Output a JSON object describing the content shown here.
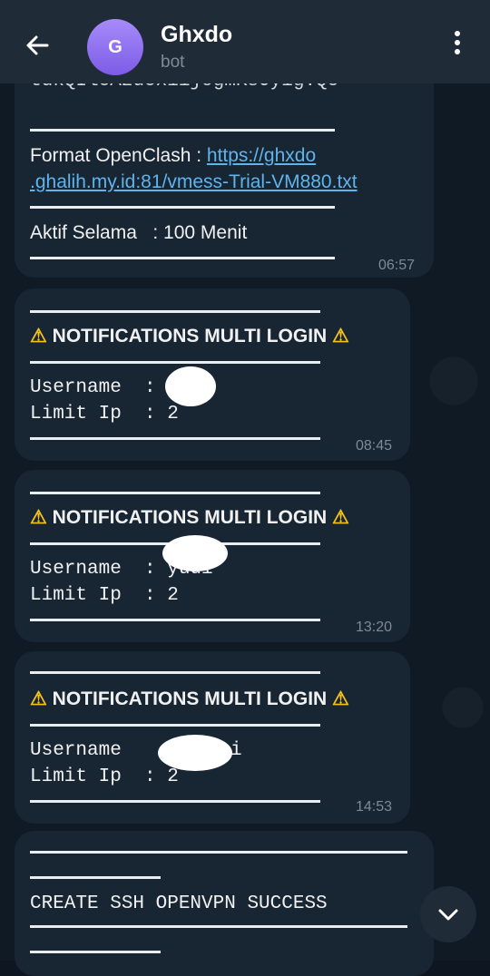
{
  "header": {
    "avatar_letter": "G",
    "title": "Ghxdo",
    "subtitle": "bot"
  },
  "messages": [
    {
      "partial_top_text": "tdkQIlcAzucxiijogmKsOyig:Qc",
      "format_label": "Format OpenClash : ",
      "format_link_line1": "https://ghxdo",
      "format_link_line2": ".ghalih.my.id:81/vmess-Trial-VM880.txt",
      "active_text": "Aktif Selama   : 100 Menit",
      "time": "06:57"
    },
    {
      "heading": "NOTIFICATIONS MULTI LOGIN",
      "username_label": "Username  :",
      "limit_label": "Limit Ip  : 2",
      "time": "08:45"
    },
    {
      "heading": "NOTIFICATIONS MULTI LOGIN",
      "username_label": "Username  : yudi",
      "limit_label": "Limit Ip  : 2",
      "time": "13:20"
    },
    {
      "heading": "NOTIFICATIONS MULTI LOGIN",
      "username_label": "Username   ",
      "username_tail": "i",
      "limit_label": "Limit Ip  : 2",
      "time": "14:53"
    },
    {
      "line": "CREATE SSH OPENVPN SUCCESS"
    }
  ],
  "icons": {
    "warning": "⚠️",
    "warning_color": "#f4c21b"
  }
}
